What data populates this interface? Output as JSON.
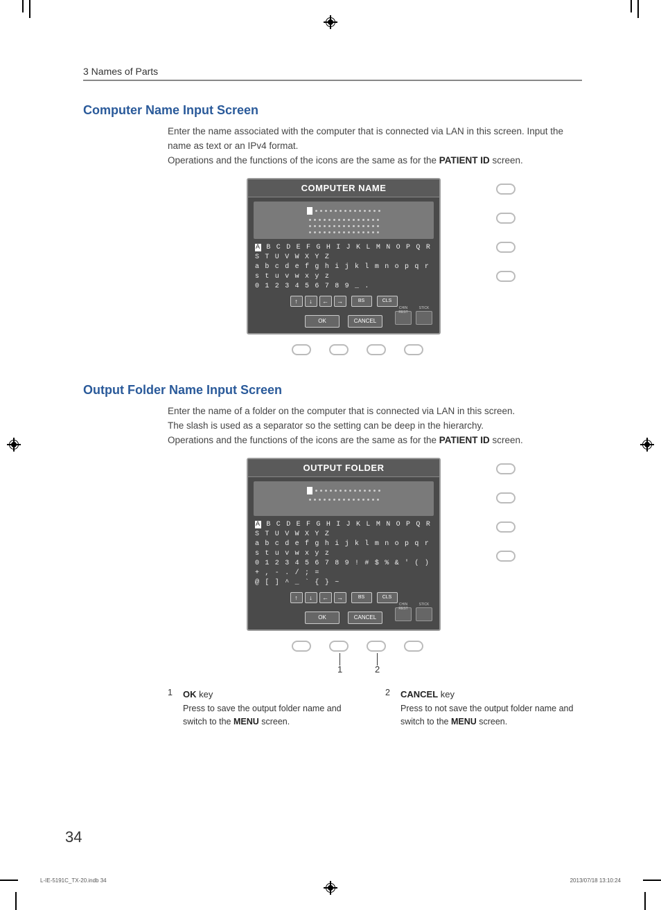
{
  "chapter": "3 Names of Parts",
  "section1": {
    "title": "Computer Name Input Screen",
    "p1": "Enter the name associated with the computer that is connected via LAN in this screen. Input the name as text or an IPv4 format.",
    "p2a": "Operations and the functions of the icons are the same as for the ",
    "p2b": "PATIENT ID",
    "p2c": " screen.",
    "screen": {
      "title": "COMPUTER NAME",
      "row_upper": "A B C D E F G H I J K L M N O P Q R S T U V W X Y Z",
      "row_lower": "a b c d e f g h i j k l m n o p q r s t u v w x y z",
      "row_digits": "0 1 2 3 4 5 6 7 8 9 _ .",
      "bs": "BS",
      "cls": "CLS",
      "ok": "OK",
      "cancel": "CANCEL",
      "chin": "CHIN REST",
      "stick": "STICK"
    }
  },
  "section2": {
    "title": "Output Folder Name Input Screen",
    "p1": "Enter the name of a folder on the computer that is connected via LAN in this screen.",
    "p2": "The slash is used as a separator so the setting can be deep in the hierarchy.",
    "p3a": "Operations and the functions of the icons are the same as for the ",
    "p3b": "PATIENT ID",
    "p3c": " screen.",
    "screen": {
      "title": "OUTPUT FOLDER",
      "row_upper": "A B C D E F G H I J K L M N O P Q R S T U V W X Y Z",
      "row_lower": "a b c d e f g h i j k l m n o p q r s t u v w x y z",
      "row_digits": "0 1 2 3 4 5 6 7 8 9   ! # $ % & ' ( ) + , - . / ; =",
      "row_sym": "@ [ ] ^ _ ` { } ~",
      "bs": "BS",
      "cls": "CLS",
      "ok": "OK",
      "cancel": "CANCEL",
      "chin": "CHIN REST",
      "stick": "STICK"
    },
    "callout1": "1",
    "callout2": "2",
    "legend": {
      "n1": "1",
      "t1a": "OK",
      "t1b": " key",
      "d1a": "Press to save the output folder name and switch to the ",
      "d1b": "MENU",
      "d1c": " screen.",
      "n2": "2",
      "t2a": "CANCEL",
      "t2b": " key",
      "d2a": "Press to not save the output folder name and switch to the ",
      "d2b": "MENU",
      "d2c": " screen."
    }
  },
  "page_num": "34",
  "footer_left": "L-IE-5191C_TX-20.indb   34",
  "footer_right": "2013/07/18   13:10:24"
}
